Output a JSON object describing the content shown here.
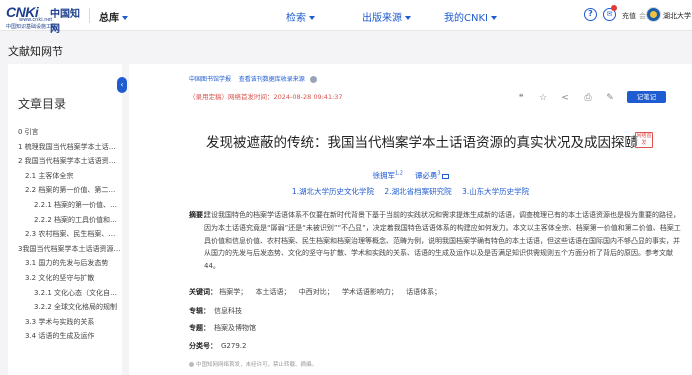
{
  "colors": {
    "brand": "#1f5bd1",
    "logo": "#1d3f8f",
    "warning": "#d9534f",
    "background": "#f4f4f6"
  },
  "header": {
    "logo_mark": "CNKi",
    "logo_cn": "中国知网",
    "logo_url": "www.cnki.net",
    "logo_sub": "中国知识基础设施工程",
    "library_label": "总库",
    "nav": [
      "检索",
      "出版来源",
      "我的CNKI"
    ],
    "icons": [
      "help-icon",
      "message-icon"
    ],
    "recharge": "充值",
    "member": "会员",
    "user_name": "湖北大学"
  },
  "section_title": "文献知网节",
  "toc": {
    "title": "文章目录",
    "items": [
      {
        "text": "0 引言",
        "level": 1
      },
      {
        "text": "1 梳理我国当代档案学本土话语资源的真实状况",
        "level": 1
      },
      {
        "text": "2 我国当代档案学本土话语资源的基本构成",
        "level": 1
      },
      {
        "text": "2.1 主客体全宗",
        "level": 2
      },
      {
        "text": "2.2 档案的第一价值、第二价值",
        "level": 2
      },
      {
        "text": "2.2.1 档案的第一价值、第二价值",
        "level": 3
      },
      {
        "text": "2.2.2 档案的工具价值和信息价值",
        "level": 3
      },
      {
        "text": "2.3 农村档案、民生档案、档案",
        "level": 2
      },
      {
        "text": "3我国当代档案学本土话语资源的成因",
        "level": 1
      },
      {
        "text": "3.1 国力的先发与后发态势",
        "level": 2
      },
      {
        "text": "3.2 文化的坚守与扩散",
        "level": 2
      },
      {
        "text": "3.2.1 文化心态（文化自信）",
        "level": 3
      },
      {
        "text": "3.2.2 全球文化格局的规制",
        "level": 3
      },
      {
        "text": "3.3 学术与实践的关系",
        "level": 2
      },
      {
        "text": "3.4 话语的生成及运作",
        "level": 2
      }
    ]
  },
  "article": {
    "source_link": "中国图书馆学报",
    "source_link2": "查看该刊数据库收录来源",
    "pub_info": "（录用定稿）网络首发时间：2024-08-28 09:41:37",
    "actions": [
      "quote-icon",
      "star-icon",
      "share-icon",
      "print-icon",
      "note-icon"
    ],
    "notes_button": "记笔记",
    "title": "发现被遮蔽的传统：我国当代档案学本土话语资源的真实状况及成因探赜",
    "title_tag": "网络首发",
    "authors": [
      {
        "name": "徐拥军",
        "sup": "1,2"
      },
      {
        "name": "谭必勇",
        "sup": "3"
      }
    ],
    "affiliations": [
      "1.湖北大学历史文化学院",
      "2.湖北省档案研究院",
      "3.山东大学历史学院"
    ],
    "abstract_label": "摘要：",
    "abstract": "建设我国特色的档案学话语体系不仅要在新时代背景下基于当前的实践状况和需求提炼生成新的话语，调查梳理已有的本土话语资源也是极为重要的路径，因为本土话语究竟是“孱弱”还是“未被识别”“不凸显”，决定着我国特色话语体系的构建应如何发力。本文以主客体全宗、档案第一价值和第二价值、档案工具价值和信息价值、农村档案、民生档案和档案治理等概念、范畴为例，说明我国档案学确有特色的本土话语，但这些话语在国际国内不够凸显的事实，并从国力的先发与后发态势、文化的坚守与扩散、学术和实践的关系、话语的生成及运作以及是否满足知识供需规则五个方面分析了背后的原因。参考文献44。",
    "keywords_label": "关键词：",
    "keywords": [
      "档案学；",
      "本土话语；",
      "中西对比；",
      "学术话语影响力；",
      "话语体系；"
    ],
    "series_label": "专辑：",
    "series": "信息科技",
    "topic_label": "专题：",
    "topic": "档案及博物馆",
    "class_label": "分类号：",
    "class_number": "G279.2",
    "footnote": "中国知网网络首发，未经许可，禁止转载、摘编。"
  }
}
